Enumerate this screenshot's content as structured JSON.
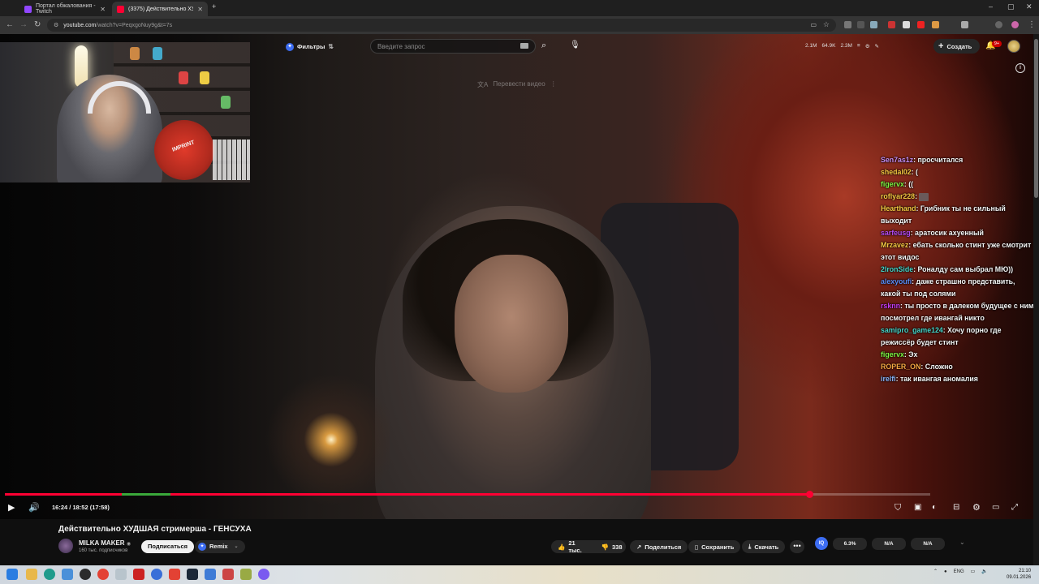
{
  "browser": {
    "tabs": [
      {
        "title": "Портал обжалования - Twitch",
        "active": false,
        "favicon_color": "#9147ff"
      },
      {
        "title": "(3375) Действительно ХУДША...",
        "active": true,
        "favicon_color": "#ff0033"
      }
    ],
    "new_tab": "+",
    "window_controls": [
      "–",
      "▢",
      "✕"
    ],
    "nav": {
      "back": "←",
      "forward": "→",
      "reload": "↻"
    },
    "url_host": "youtube.com",
    "url_path": "/watch?v=PeqxgoNuy9g&t=7s"
  },
  "header": {
    "filters_label": "Фильтры",
    "filters_icon": "bold-filter-icon",
    "search_placeholder": "Введите запрос",
    "stats": [
      "2.1M",
      "64.9K",
      "2.3M"
    ],
    "create_label": "Создать",
    "notifications_count": "9+"
  },
  "video": {
    "translate_label": "Перевести видео",
    "webcam_mic_label": "IMPRINT"
  },
  "chat": [
    {
      "user": "Sen7as1z",
      "color": "#c38bf0",
      "text": "просчитался"
    },
    {
      "user": "shedal02",
      "color": "#f5c842",
      "text": "("
    },
    {
      "user": "figervx",
      "color": "#7cf542",
      "text": "(("
    },
    {
      "user": "roflyar228",
      "color": "#f5c842",
      "text": "",
      "emote": true
    },
    {
      "user": "Hearthand",
      "color": "#f5c842",
      "text": "Грибник ты не сильный выходит"
    },
    {
      "user": "sarfeusg",
      "color": "#b44bf5",
      "text": "аратосик ахуенный"
    },
    {
      "user": "Mrzavez",
      "color": "#f5c842",
      "text": "ебать сколько стинт уже смотрит этот видос"
    },
    {
      "user": "2IronSide",
      "color": "#44d4c8",
      "text": "Роналду сам выбрал МЮ))"
    },
    {
      "user": "alexyoufi",
      "color": "#5a8cf5",
      "text": "даже страшно представить, какой ты под солями"
    },
    {
      "user": "rsknn",
      "color": "#c43bf5",
      "text": "ты просто в далеком будущее с ним посмотрел где ивангай никто"
    },
    {
      "user": "samipro_game124",
      "color": "#44d4c8",
      "text": "Хочу порно где режиссёр будет стинт"
    },
    {
      "user": "figervx",
      "color": "#7cf542",
      "text": "Эх"
    },
    {
      "user": "ROPER_ON",
      "color": "#f5a742",
      "text": "Сложно"
    },
    {
      "user": "irelfi",
      "color": "#8ab4f8",
      "text": "так ивангая аномалия"
    }
  ],
  "player": {
    "time_current": "16:24",
    "time_total": "18:52",
    "time_extra": "(17:58)",
    "progress": 0.869,
    "accent": "#ff0033"
  },
  "info": {
    "title": "Действительно ХУДШАЯ стримерша - ГЕНСУХА",
    "channel": "MILKA MAKER",
    "verified": "◉",
    "subscribers": "160 тыс. подписчиков",
    "subscribe_label": "Подписаться",
    "remix_label": "Remix",
    "likes": "21 тыс.",
    "dislikes": "338",
    "share_label": "Поделиться",
    "save_label": "Сохранить",
    "download_label": "Скачать",
    "more_label": "•••"
  },
  "extension_panel": {
    "logo": "IQ",
    "values": [
      "6.3%",
      "N/A",
      "N/A"
    ]
  },
  "taskbar": {
    "lang": "ENG",
    "time": "21:10",
    "date": "09.01.2026"
  }
}
